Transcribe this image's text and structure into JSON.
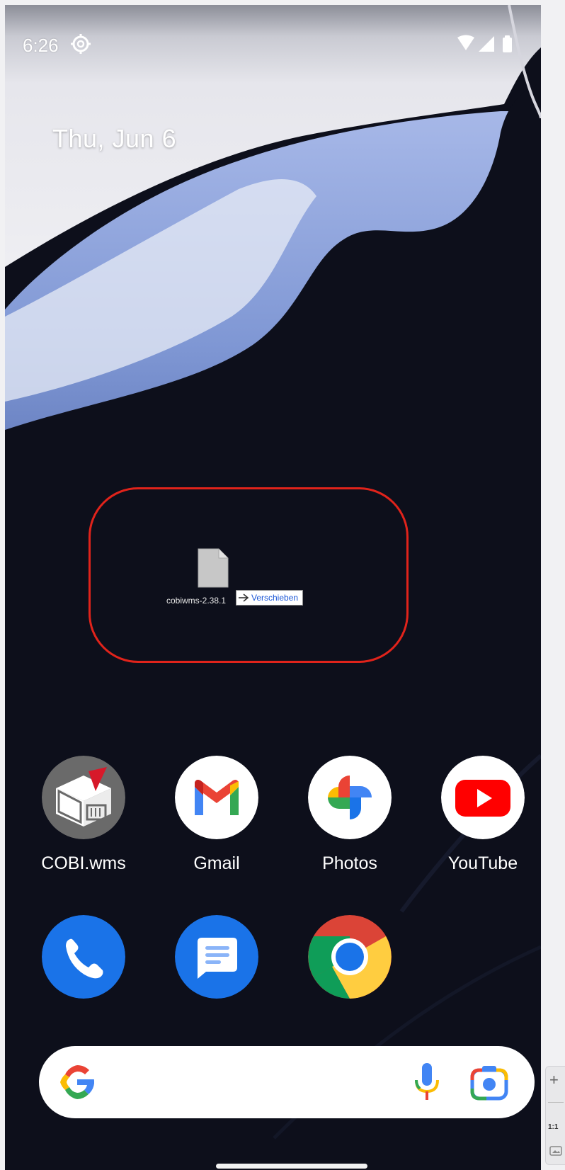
{
  "status_bar": {
    "time": "6:26",
    "settings_icon": "settings-gear-icon",
    "wifi_icon": "wifi-icon",
    "signal_icon": "cell-signal-icon",
    "battery_icon": "battery-icon"
  },
  "date_widget": {
    "date": "Thu, Jun 6"
  },
  "drag_overlay": {
    "highlight_color": "#e0231b",
    "file_icon": "file-icon",
    "file_name": "cobiwms-2.38.1",
    "action_icon": "arrow-right-icon",
    "action_label": "Verschieben"
  },
  "apps_row_1": [
    {
      "label": "COBI.wms",
      "icon": "cobi-wms-app-icon"
    },
    {
      "label": "Gmail",
      "icon": "gmail-app-icon"
    },
    {
      "label": "Photos",
      "icon": "photos-app-icon"
    },
    {
      "label": "YouTube",
      "icon": "youtube-app-icon"
    }
  ],
  "dock": [
    {
      "icon": "phone-app-icon"
    },
    {
      "icon": "messages-app-icon"
    },
    {
      "icon": "chrome-app-icon"
    }
  ],
  "search_bar": {
    "google_icon": "google-g-icon",
    "mic_icon": "microphone-icon",
    "lens_icon": "google-lens-icon"
  },
  "side_tool": {
    "plus": "+",
    "ratio": "1:1"
  },
  "colors": {
    "wallpaper_dark": "#0d0f1b",
    "wallpaper_blue": "#8ea6de",
    "dock_blue": "#1a73e8"
  }
}
